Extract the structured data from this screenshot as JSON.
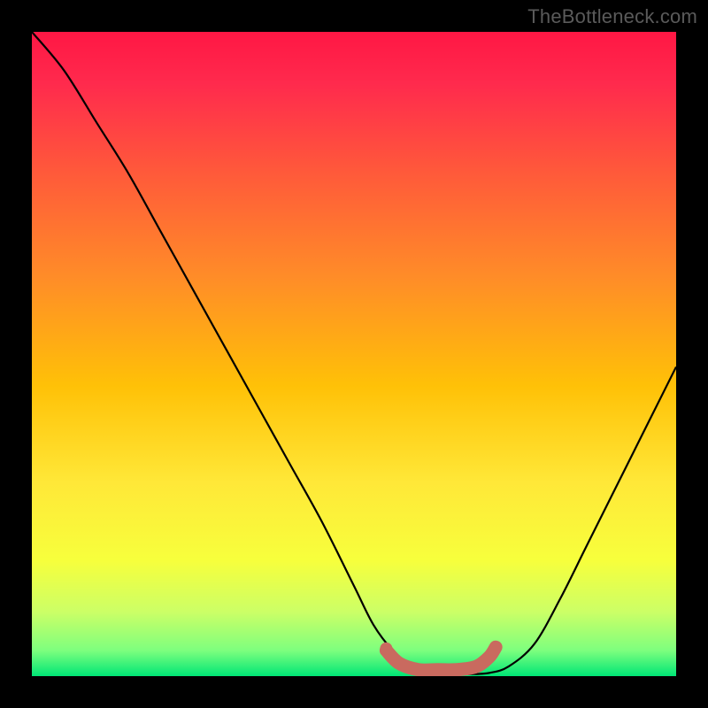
{
  "watermark": "TheBottleneck.com",
  "chart_data": {
    "type": "line",
    "title": "",
    "xlabel": "",
    "ylabel": "",
    "xlim": [
      0,
      100
    ],
    "ylim": [
      0,
      100
    ],
    "grid": false,
    "legend": false,
    "background_gradient": {
      "stops": [
        {
          "offset": 0,
          "color": "#ff1744"
        },
        {
          "offset": 0.08,
          "color": "#ff2a4d"
        },
        {
          "offset": 0.22,
          "color": "#ff5a3a"
        },
        {
          "offset": 0.38,
          "color": "#ff8c28"
        },
        {
          "offset": 0.55,
          "color": "#ffc107"
        },
        {
          "offset": 0.7,
          "color": "#ffe838"
        },
        {
          "offset": 0.82,
          "color": "#f7ff3c"
        },
        {
          "offset": 0.9,
          "color": "#ccff66"
        },
        {
          "offset": 0.96,
          "color": "#7eff7e"
        },
        {
          "offset": 1.0,
          "color": "#00e676"
        }
      ]
    },
    "series": [
      {
        "name": "bottleneck-curve",
        "color": "#000000",
        "x": [
          0,
          5,
          10,
          15,
          20,
          25,
          30,
          35,
          40,
          45,
          50,
          53,
          56,
          59,
          62,
          65,
          68,
          71,
          74,
          78,
          82,
          86,
          90,
          94,
          98,
          100
        ],
        "y": [
          100,
          94,
          86,
          78,
          69,
          60,
          51,
          42,
          33,
          24,
          14,
          8,
          4,
          1.5,
          0.5,
          0.3,
          0.3,
          0.5,
          1.5,
          5,
          12,
          20,
          28,
          36,
          44,
          48
        ]
      },
      {
        "name": "optimal-zone-marker",
        "type": "marker",
        "color": "#c96a5f",
        "x": [
          55,
          57,
          60,
          63,
          66,
          69,
          71,
          72
        ],
        "y": [
          4,
          2,
          1,
          1,
          1,
          1.5,
          3,
          4.5
        ]
      }
    ],
    "annotations": []
  }
}
